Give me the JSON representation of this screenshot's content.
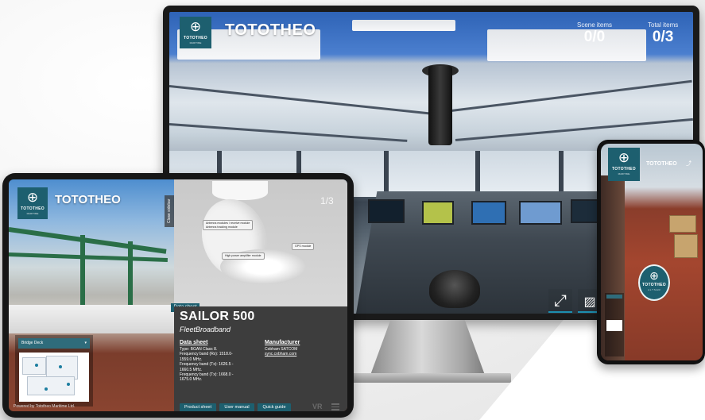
{
  "brand": {
    "name": "TOTOTHEO",
    "logo_word": "TOTOTHEO",
    "logo_tagline": "MARITIME",
    "colors": {
      "primary": "#1d5f6f",
      "accent": "#1d8fb0"
    }
  },
  "monitor": {
    "scene_items_label": "Scene items",
    "scene_items_value": "0/0",
    "total_items_label": "Total items",
    "total_items_value": "0/3",
    "fullscreen_icon": "expand-arrows-icon",
    "gallery_icon": "image-gallery-icon"
  },
  "tablet": {
    "close_sidebar_label": "Close sidebar",
    "page_indicator": "1/3",
    "callouts": {
      "c1a": "Antenna modules / receive module",
      "c1b": "Antenna tracking module",
      "c2": "GPS module",
      "c3": "High power amplifier module"
    },
    "data_sheet_tab": "Data sheet",
    "minimap_select": "Bridge Deck",
    "powered_by": "Powered by Tototheo Maritime Ltd.",
    "product": {
      "title": "SAILOR 500",
      "subtitle": "FleetBroadband",
      "data_sheet_heading": "Data sheet",
      "specs": [
        "Type: BGAN Class 8.",
        "Frequency band (Rx): 1518.0-",
        "1559.0 MHz.",
        "Frequency band (Tx): 1626.5 -",
        "1660.5 MHz.",
        "Frequency band (Tx): 1668.0 -",
        "1675.0 MHz."
      ],
      "manufacturer_heading": "Manufacturer",
      "manufacturer_name": "Cobham SATCOM",
      "manufacturer_link": "sync.cobham.com"
    },
    "buttons": {
      "product_sheet": "Product sheet",
      "user_manual": "User manual",
      "quick_guide": "Quick guide"
    },
    "vr_label": "VR"
  },
  "phone": {
    "brand_name": "TOTOTHEO",
    "badge_word": "TOTOTHEO",
    "badge_tagline": "A L T S E R"
  }
}
